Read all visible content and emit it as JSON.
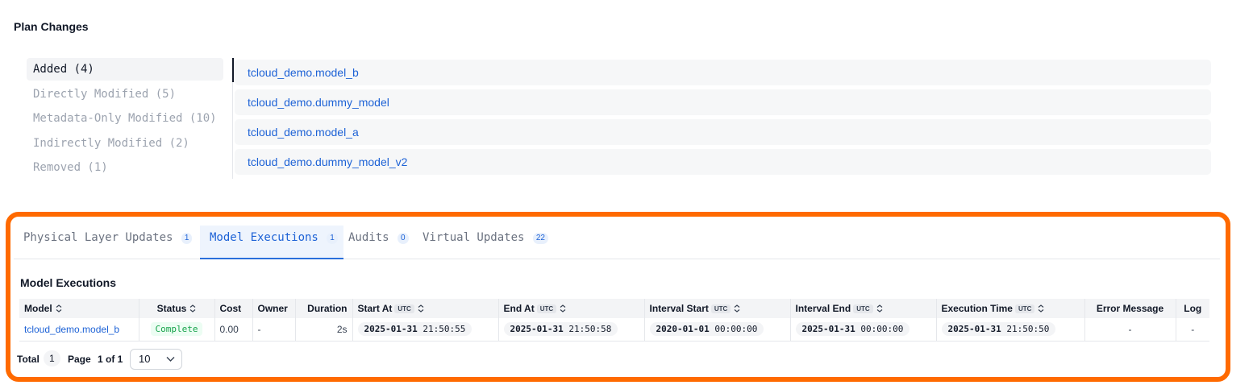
{
  "plan_changes": {
    "title": "Plan Changes",
    "categories": [
      {
        "label": "Added (4)",
        "active": true
      },
      {
        "label": "Directly Modified (5)",
        "active": false
      },
      {
        "label": "Metadata-Only Modified (10)",
        "active": false
      },
      {
        "label": "Indirectly Modified (2)",
        "active": false
      },
      {
        "label": "Removed (1)",
        "active": false
      }
    ],
    "models": [
      "tcloud_demo.model_b",
      "tcloud_demo.dummy_model",
      "tcloud_demo.model_a",
      "tcloud_demo.dummy_model_v2"
    ]
  },
  "tabs": [
    {
      "label": "Physical Layer Updates",
      "count": "1",
      "active": false
    },
    {
      "label": "Model Executions",
      "count": "1",
      "active": true
    },
    {
      "label": "Audits",
      "count": "0",
      "active": false
    },
    {
      "label": "Virtual Updates",
      "count": "22",
      "active": false
    }
  ],
  "executions": {
    "title": "Model Executions",
    "columns": {
      "model": "Model",
      "status": "Status",
      "cost": "Cost",
      "owner": "Owner",
      "duration": "Duration",
      "start_at": "Start At",
      "end_at": "End At",
      "interval_start": "Interval Start",
      "interval_end": "Interval End",
      "execution_time": "Execution Time",
      "error_message": "Error Message",
      "log": "Log"
    },
    "utc_label": "UTC",
    "rows": [
      {
        "model": "tcloud_demo.model_b",
        "status": "Complete",
        "cost": "0.00",
        "owner": "-",
        "duration": "2s",
        "start_date": "2025-01-31",
        "start_time": "21:50:55",
        "end_date": "2025-01-31",
        "end_time": "21:50:58",
        "interval_start_date": "2020-01-01",
        "interval_start_time": "00:00:00",
        "interval_end_date": "2025-01-31",
        "interval_end_time": "00:00:00",
        "execution_date": "2025-01-31",
        "execution_time": "21:50:50",
        "error_message": "-",
        "log": "-"
      }
    ]
  },
  "pagination": {
    "total_label": "Total",
    "total": "1",
    "page_label": "Page",
    "page_value": "1 of 1",
    "page_size": "10"
  },
  "colors": {
    "accent": "#1d62d6",
    "highlight": "#ff6a00",
    "status_complete": "#16a34a"
  }
}
